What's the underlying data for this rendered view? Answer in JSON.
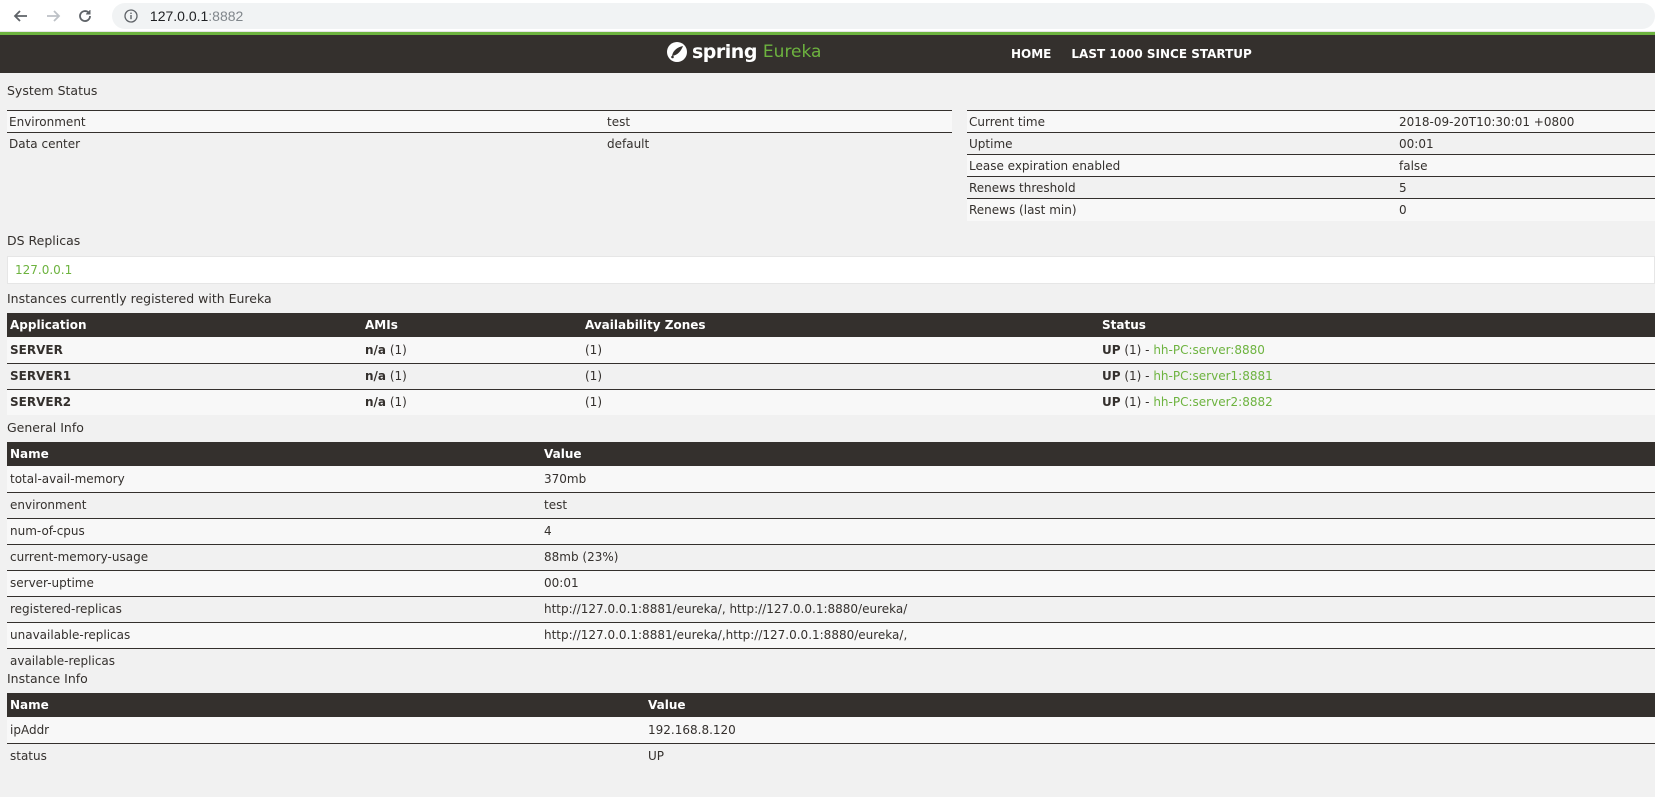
{
  "browser": {
    "url_host": "127.0.0.1",
    "url_port": ":8882"
  },
  "header": {
    "brand_spring": "spring",
    "brand_eureka": "Eureka",
    "nav": [
      "HOME",
      "LAST 1000 SINCE STARTUP"
    ]
  },
  "system_status": {
    "title": "System Status",
    "left": [
      {
        "label": "Environment",
        "value": "test"
      },
      {
        "label": "Data center",
        "value": "default"
      }
    ],
    "right": [
      {
        "label": "Current time",
        "value": "2018-09-20T10:30:01 +0800"
      },
      {
        "label": "Uptime",
        "value": "00:01"
      },
      {
        "label": "Lease expiration enabled",
        "value": "false"
      },
      {
        "label": "Renews threshold",
        "value": "5"
      },
      {
        "label": "Renews (last min)",
        "value": "0"
      }
    ]
  },
  "ds_replicas": {
    "title": "DS Replicas",
    "replica": "127.0.0.1"
  },
  "instances": {
    "title": "Instances currently registered with Eureka",
    "headers": [
      "Application",
      "AMIs",
      "Availability Zones",
      "Status"
    ],
    "rows": [
      {
        "app": "SERVER",
        "ami_bold": "n/a",
        "ami_count": " (1)",
        "zones": "(1)",
        "status_bold": "UP",
        "status_count": " (1) - ",
        "instance": "hh-PC:server:8880"
      },
      {
        "app": "SERVER1",
        "ami_bold": "n/a",
        "ami_count": " (1)",
        "zones": "(1)",
        "status_bold": "UP",
        "status_count": " (1) - ",
        "instance": "hh-PC:server1:8881"
      },
      {
        "app": "SERVER2",
        "ami_bold": "n/a",
        "ami_count": " (1)",
        "zones": "(1)",
        "status_bold": "UP",
        "status_count": " (1) - ",
        "instance": "hh-PC:server2:8882"
      }
    ]
  },
  "general_info": {
    "title": "General Info",
    "headers": [
      "Name",
      "Value"
    ],
    "rows": [
      {
        "name": "total-avail-memory",
        "value": "370mb"
      },
      {
        "name": "environment",
        "value": "test"
      },
      {
        "name": "num-of-cpus",
        "value": "4"
      },
      {
        "name": "current-memory-usage",
        "value": "88mb (23%)"
      },
      {
        "name": "server-uptime",
        "value": "00:01"
      },
      {
        "name": "registered-replicas",
        "value": "http://127.0.0.1:8881/eureka/, http://127.0.0.1:8880/eureka/"
      },
      {
        "name": "unavailable-replicas",
        "value": "http://127.0.0.1:8881/eureka/,http://127.0.0.1:8880/eureka/,"
      },
      {
        "name": "available-replicas",
        "value": ""
      }
    ]
  },
  "instance_info": {
    "title": "Instance Info",
    "headers": [
      "Name",
      "Value"
    ],
    "rows": [
      {
        "name": "ipAddr",
        "value": "192.168.8.120"
      },
      {
        "name": "status",
        "value": "UP"
      }
    ]
  }
}
